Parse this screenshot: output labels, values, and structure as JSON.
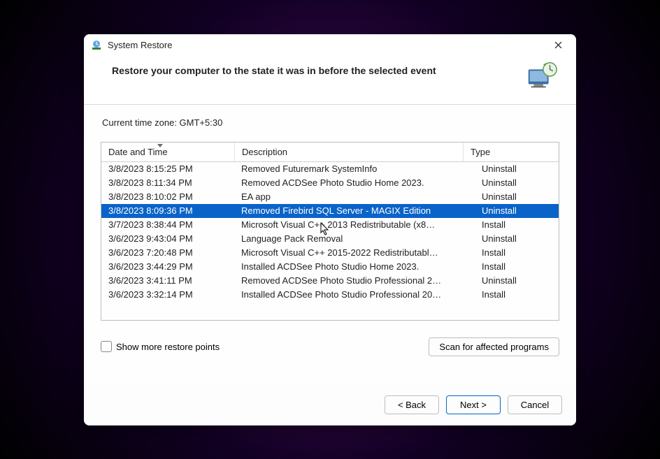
{
  "window_title": "System Restore",
  "heading": "Restore your computer to the state it was in before the selected event",
  "timezone_label": "Current time zone: GMT+5:30",
  "columns": {
    "date_time": "Date and Time",
    "description": "Description",
    "type": "Type"
  },
  "selected_index": 3,
  "rows": [
    {
      "dt": "3/8/2023 8:15:25 PM",
      "desc": "Removed Futuremark SystemInfo",
      "type": "Uninstall"
    },
    {
      "dt": "3/8/2023 8:11:34 PM",
      "desc": "Removed ACDSee Photo Studio Home 2023.",
      "type": "Uninstall"
    },
    {
      "dt": "3/8/2023 8:10:02 PM",
      "desc": "EA app",
      "type": "Uninstall"
    },
    {
      "dt": "3/8/2023 8:09:36 PM",
      "desc": "Removed Firebird SQL Server - MAGIX Edition",
      "type": "Uninstall"
    },
    {
      "dt": "3/7/2023 8:38:44 PM",
      "desc": "Microsoft Visual C++ 2013 Redistributable (x8…",
      "type": "Install"
    },
    {
      "dt": "3/6/2023 9:43:04 PM",
      "desc": "Language Pack Removal",
      "type": "Uninstall"
    },
    {
      "dt": "3/6/2023 7:20:48 PM",
      "desc": "Microsoft Visual C++ 2015-2022 Redistributabl…",
      "type": "Install"
    },
    {
      "dt": "3/6/2023 3:44:29 PM",
      "desc": "Installed ACDSee Photo Studio Home 2023.",
      "type": "Install"
    },
    {
      "dt": "3/6/2023 3:41:11 PM",
      "desc": "Removed ACDSee Photo Studio Professional 2…",
      "type": "Uninstall"
    },
    {
      "dt": "3/6/2023 3:32:14 PM",
      "desc": "Installed ACDSee Photo Studio Professional 20…",
      "type": "Install"
    }
  ],
  "show_more_label": "Show more restore points",
  "scan_button": "Scan for affected programs",
  "back_button": "< Back",
  "next_button": "Next >",
  "cancel_button": "Cancel",
  "icons": {
    "app": "system-restore-icon",
    "hero": "monitor-clock-icon",
    "close": "close-icon"
  }
}
